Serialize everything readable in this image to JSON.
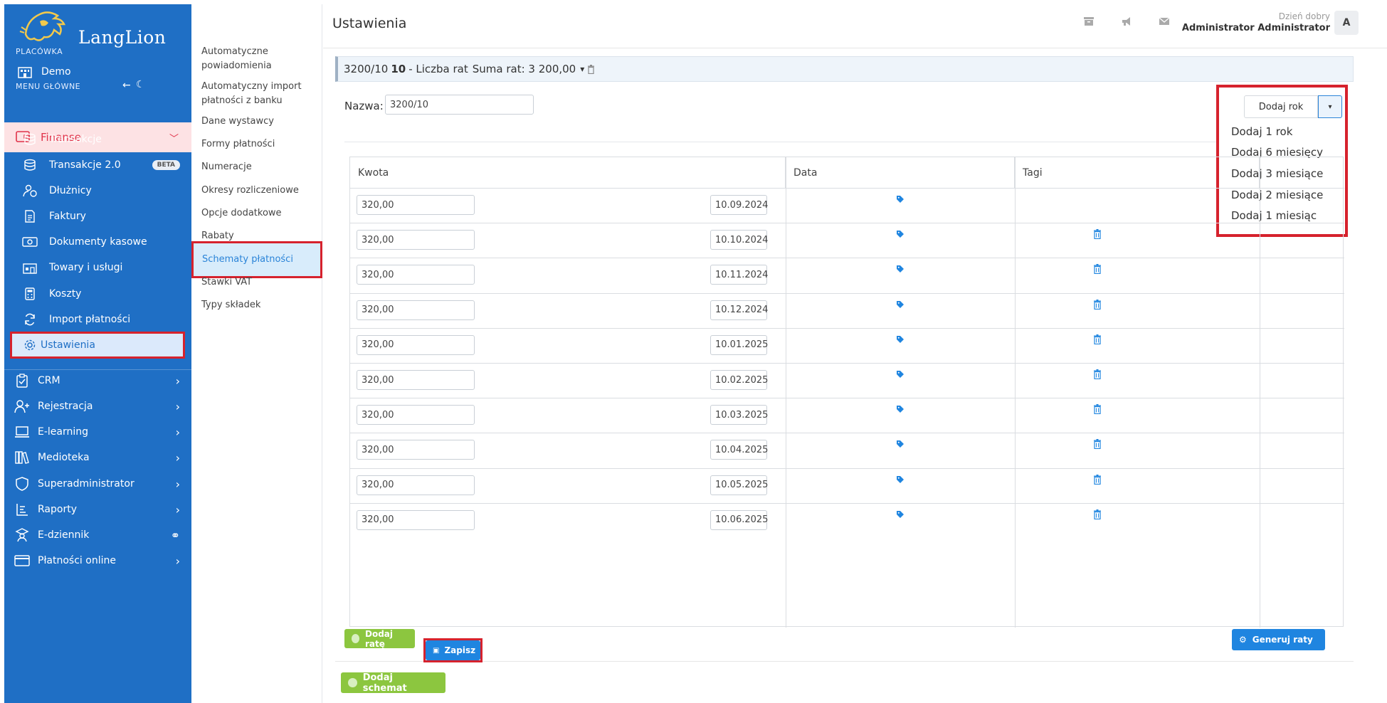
{
  "brand": {
    "logo_text": "LangLion"
  },
  "sidebar": {
    "placowka_label": "PLACÓWKA",
    "placowka_name": "Demo",
    "menu_label": "MENU GŁÓWNE",
    "finanse": "Finanse",
    "finanse_items": [
      {
        "label": "Transakcje",
        "icon": "database-icon"
      },
      {
        "label": "Transakcje 2.0",
        "icon": "database-icon",
        "badge": "BETA"
      },
      {
        "label": "Dłużnicy",
        "icon": "user-clock-icon"
      },
      {
        "label": "Faktury",
        "icon": "invoice-icon"
      },
      {
        "label": "Dokumenty kasowe",
        "icon": "cash-icon"
      },
      {
        "label": "Towary i usługi",
        "icon": "shop-icon"
      },
      {
        "label": "Koszty",
        "icon": "calculator-icon"
      },
      {
        "label": "Import płatności",
        "icon": "sync-icon"
      },
      {
        "label": "Ustawienia",
        "icon": "gear-icon"
      }
    ],
    "groups": [
      {
        "label": "CRM",
        "icon": "clipboard-icon"
      },
      {
        "label": "Rejestracja",
        "icon": "user-plus-icon"
      },
      {
        "label": "E-learning",
        "icon": "laptop-icon"
      },
      {
        "label": "Medioteka",
        "icon": "books-icon"
      },
      {
        "label": "Superadministrator",
        "icon": "shield-icon"
      },
      {
        "label": "Raporty",
        "icon": "report-icon"
      },
      {
        "label": "E-dziennik",
        "icon": "teacher-icon"
      },
      {
        "label": "Płatności online",
        "icon": "card-icon"
      }
    ]
  },
  "subnav": {
    "items": [
      "Automatyczne powiadomienia",
      "Automatyczny import płatności z banku",
      "Dane wystawcy",
      "Formy płatności",
      "Numeracje",
      "Okresy rozliczeniowe",
      "Opcje dodatkowe",
      "Rabaty",
      "Schematy płatności",
      "Stawki VAT",
      "Typy składek"
    ]
  },
  "header": {
    "title": "Ustawienia",
    "greeting": "Dzień dobry",
    "user": "Administrator Administrator",
    "avatar": "A"
  },
  "scheme": {
    "code": "3200/10",
    "count": "10",
    "count_label": "- Liczba rat",
    "sum_label": "Suma rat: 3 200,00",
    "name_label": "Nazwa:",
    "name_value": "3200/10"
  },
  "dropdown": {
    "button": "Dodaj rok",
    "options": [
      "Dodaj 1 rok",
      "Dodaj 6 miesięcy",
      "Dodaj 3 miesiące",
      "Dodaj 2 miesiące",
      "Dodaj 1 miesiąc"
    ]
  },
  "table": {
    "headers": {
      "amount": "Kwota",
      "date": "Data",
      "tags": "Tagi"
    },
    "rows": [
      {
        "amount": "320,00",
        "date": "10.09.2024"
      },
      {
        "amount": "320,00",
        "date": "10.10.2024"
      },
      {
        "amount": "320,00",
        "date": "10.11.2024"
      },
      {
        "amount": "320,00",
        "date": "10.12.2024"
      },
      {
        "amount": "320,00",
        "date": "10.01.2025"
      },
      {
        "amount": "320,00",
        "date": "10.02.2025"
      },
      {
        "amount": "320,00",
        "date": "10.03.2025"
      },
      {
        "amount": "320,00",
        "date": "10.04.2025"
      },
      {
        "amount": "320,00",
        "date": "10.05.2025"
      },
      {
        "amount": "320,00",
        "date": "10.06.2025"
      }
    ]
  },
  "buttons": {
    "add_rate": "Dodaj ratę",
    "save": "Zapisz",
    "generate": "Generuj raty",
    "add_scheme": "Dodaj schemat"
  },
  "colors": {
    "sidebar": "#1f6fc5",
    "highlight": "#d6222d",
    "finanse": "#e0334a",
    "green": "#8cc63f",
    "blue": "#1f85e0"
  }
}
